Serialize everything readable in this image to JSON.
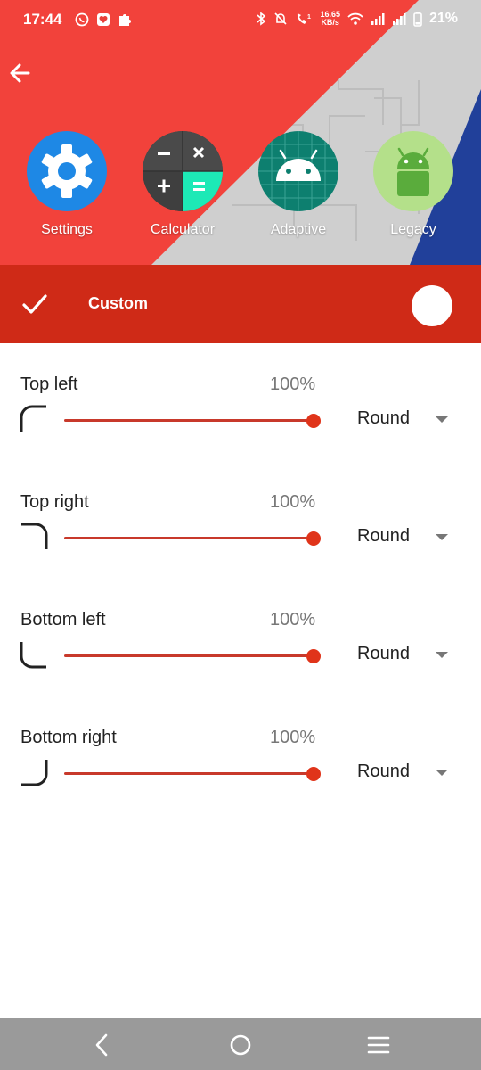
{
  "status_bar": {
    "time": "17:44",
    "speed_top": "16.65",
    "speed_bottom": "KB/s",
    "battery": "21%",
    "icons": [
      "whatsapp-icon",
      "heart-icon",
      "puzzle-icon",
      "bluetooth-icon",
      "mute-icon",
      "call-icon",
      "wifi-icon",
      "signal-icon",
      "signal-icon",
      "battery-icon"
    ]
  },
  "header": {
    "icons": [
      {
        "label": "Settings",
        "name": "settings-app-icon"
      },
      {
        "label": "Calculator",
        "name": "calculator-app-icon"
      },
      {
        "label": "Adaptive",
        "name": "adaptive-app-icon"
      },
      {
        "label": "Legacy",
        "name": "legacy-app-icon"
      }
    ],
    "colors": {
      "red": "#f2423b",
      "grey": "#cfcfcf",
      "blue": "#21409a"
    }
  },
  "toolbar": {
    "title": "Custom",
    "color": "#cf2a17"
  },
  "corners": [
    {
      "label": "Top left",
      "percent": "100%",
      "value": 1.0,
      "shape": "Round"
    },
    {
      "label": "Top right",
      "percent": "100%",
      "value": 1.0,
      "shape": "Round"
    },
    {
      "label": "Bottom left",
      "percent": "100%",
      "value": 1.0,
      "shape": "Round"
    },
    {
      "label": "Bottom right",
      "percent": "100%",
      "value": 1.0,
      "shape": "Round"
    }
  ],
  "colors": {
    "accent": "#e0341a",
    "track": "#c8392b",
    "nav": "#9a9a9a"
  }
}
